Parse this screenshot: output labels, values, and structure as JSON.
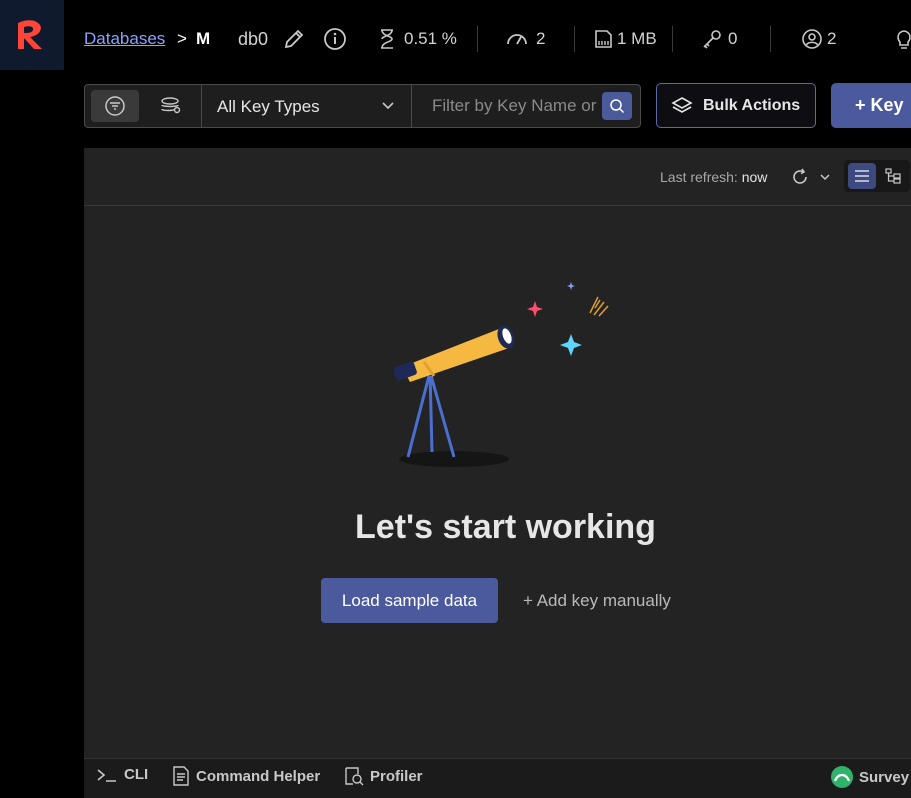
{
  "breadcrumb": {
    "link": "Databases",
    "separator": ">",
    "current": "M"
  },
  "db": {
    "index": "db0"
  },
  "stats": {
    "cpu": "0.51 %",
    "ops": "2",
    "memory": "1 MB",
    "keys": "0",
    "clients": "2"
  },
  "filter": {
    "key_type": "All Key Types",
    "search_placeholder": "Filter by Key Name or Pattern"
  },
  "actions": {
    "bulk": "Bulk Actions",
    "add_key": "+ Key"
  },
  "panel": {
    "refresh_label": "Last refresh:",
    "refresh_value": "now",
    "empty_title": "Let's start working",
    "load_sample": "Load sample data",
    "add_manual": "+ Add key manually"
  },
  "bottombar": {
    "cli": "CLI",
    "command_helper": "Command Helper",
    "profiler": "Profiler",
    "survey": "Survey"
  },
  "colors": {
    "accent": "#4b5a9c",
    "brand": "#ff4438",
    "link": "#8aa2ff"
  }
}
